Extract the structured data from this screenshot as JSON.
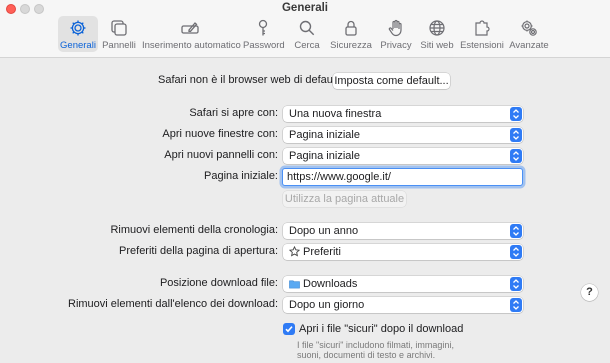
{
  "window": {
    "title": "Generali"
  },
  "tabs": [
    {
      "id": "generali",
      "label": "Generali",
      "icon": "gear-icon",
      "active": true
    },
    {
      "id": "pannelli",
      "label": "Pannelli",
      "icon": "tabs-icon",
      "active": false
    },
    {
      "id": "autofill",
      "label": "Inserimento automatico",
      "icon": "pencil-field-icon",
      "active": false
    },
    {
      "id": "password",
      "label": "Password",
      "icon": "key-icon",
      "active": false
    },
    {
      "id": "cerca",
      "label": "Cerca",
      "icon": "search-icon",
      "active": false
    },
    {
      "id": "sicurezza",
      "label": "Sicurezza",
      "icon": "lock-icon",
      "active": false
    },
    {
      "id": "privacy",
      "label": "Privacy",
      "icon": "hand-icon",
      "active": false
    },
    {
      "id": "siti",
      "label": "Siti web",
      "icon": "globe-icon",
      "active": false
    },
    {
      "id": "estensioni",
      "label": "Estensioni",
      "icon": "puzzle-icon",
      "active": false
    },
    {
      "id": "avanzate",
      "label": "Avanzate",
      "icon": "gears-icon",
      "active": false
    }
  ],
  "default_browser": {
    "message": "Safari non è il browser web di default.",
    "button_label": "Imposta come default..."
  },
  "settings": {
    "opens_with": {
      "label": "Safari si apre con:",
      "value": "Una nuova finestra"
    },
    "new_windows": {
      "label": "Apri nuove finestre con:",
      "value": "Pagina iniziale"
    },
    "new_tabs": {
      "label": "Apri nuovi pannelli con:",
      "value": "Pagina iniziale"
    },
    "homepage": {
      "label": "Pagina iniziale:",
      "value": "https://www.google.it/"
    },
    "use_current_label": "Utilizza la pagina attuale",
    "history": {
      "label": "Rimuovi elementi della cronologia:",
      "value": "Dopo un anno"
    },
    "favorites": {
      "label": "Preferiti della pagina di apertura:",
      "value": "Preferiti"
    },
    "download_location": {
      "label": "Posizione download file:",
      "value": "Downloads"
    },
    "download_list": {
      "label": "Rimuovi elementi dall'elenco dei download:",
      "value": "Dopo un giorno"
    },
    "safe_files": {
      "label": "Apri i file \"sicuri\" dopo il download",
      "checked": true,
      "note_line1": "I file \"sicuri\" includono filmati, immagini,",
      "note_line2": "suoni, documenti di testo e archivi."
    }
  },
  "help_label": "?",
  "colors": {
    "accent": "#2f7bf5",
    "close": "#ff5f57"
  }
}
